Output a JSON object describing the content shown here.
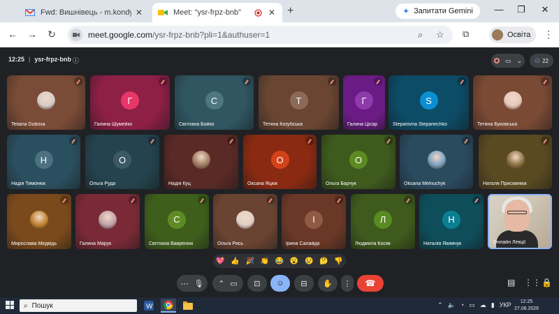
{
  "browser": {
    "tabs": [
      {
        "title": "Fwd: Вишнівець - m.kondyrjeva@",
        "icon": "gmail-icon",
        "active": false
      },
      {
        "title": "Meet: \"ysr-frpz-bnb\"",
        "icon": "meet-icon",
        "active": true
      }
    ],
    "gemini_button": "Запитати Gemini",
    "url_host": "meet.google.com",
    "url_rest": "/ysr-frpz-bnb?pli=1&authuser=1",
    "profile_name": "Освіта"
  },
  "meeting": {
    "time": "12:25",
    "code": "ysr-frpz-bnb",
    "participants_count": "22",
    "tiles": [
      {
        "name": "Tetiana Dubova",
        "letter": "",
        "photo": true,
        "color": "#7a4b36",
        "avcolor": "#d7ccc8"
      },
      {
        "name": "Галина Шумейко",
        "letter": "Г",
        "photo": false,
        "color": "#8e1f45",
        "avcolor": "#e8366a"
      },
      {
        "name": "Світлана Бойко",
        "letter": "С",
        "photo": false,
        "color": "#2f5661",
        "avcolor": "#4f7782"
      },
      {
        "name": "Тетяна Козубська",
        "letter": "Т",
        "photo": false,
        "color": "#6a4632",
        "avcolor": "#8b6a58"
      },
      {
        "name": "Галина Цісар",
        "letter": "Г",
        "photo": false,
        "color": "#6a1b84",
        "avcolor": "#8e3aaa"
      },
      {
        "name": "Stepanivna Stepanechko",
        "letter": "S",
        "photo": false,
        "color": "#0d4c66",
        "avcolor": "#0b8fd3"
      },
      {
        "name": "Тетяна Буковська",
        "letter": "",
        "photo": true,
        "color": "#7a4a35",
        "avcolor": "#e8c8b8"
      },
      {
        "name": "Надія Тимонюк",
        "letter": "Н",
        "photo": false,
        "color": "#2a4f5e",
        "avcolor": "#4d7181"
      },
      {
        "name": "Ольга Руда",
        "letter": "О",
        "photo": false,
        "color": "#24434e",
        "avcolor": "#3b5964"
      },
      {
        "name": "Надія Куц",
        "letter": "",
        "photo": true,
        "color": "#5a2a26",
        "avcolor": "#a07a62"
      },
      {
        "name": "Оксана Яцюк",
        "letter": "О",
        "photo": false,
        "color": "#8a2a12",
        "avcolor": "#d4421a"
      },
      {
        "name": "Ольга Барчук",
        "letter": "О",
        "photo": false,
        "color": "#3e5a1d",
        "avcolor": "#5d8a22"
      },
      {
        "name": "Oksana Melnuchyk",
        "letter": "",
        "photo": true,
        "color": "#2a4a5e",
        "avcolor": "#7aa0c0"
      },
      {
        "name": "Наталя Присяжнюк",
        "letter": "",
        "photo": true,
        "color": "#5a4a22",
        "avcolor": "#8a7040"
      },
      {
        "name": "Мирослава Медвідь",
        "letter": "",
        "photo": true,
        "color": "#7a4a1c",
        "avcolor": "#c08030"
      },
      {
        "name": "Галина Марук",
        "letter": "",
        "photo": true,
        "color": "#7a2a36",
        "avcolor": "#c0a0a8"
      },
      {
        "name": "Світлана Вавренюк",
        "letter": "С",
        "photo": false,
        "color": "#3e5e1c",
        "avcolor": "#5d8c24"
      },
      {
        "name": "Ольга Рись",
        "letter": "",
        "photo": true,
        "color": "#6a4432",
        "avcolor": "#e0d0c8"
      },
      {
        "name": "Ірина Салайда",
        "letter": "І",
        "photo": false,
        "color": "#6a3826",
        "avcolor": "#8e5a44"
      },
      {
        "name": "Людмила Косяк",
        "letter": "Л",
        "photo": false,
        "color": "#3e5a1c",
        "avcolor": "#5a8a22"
      },
      {
        "name": "Наталія Якимчук",
        "letter": "Н",
        "photo": false,
        "color": "#0e4e5a",
        "avcolor": "#0b7f92"
      },
      {
        "name": "Онлайн Лекції",
        "letter": "",
        "photo": true,
        "color": "#cfc6b6",
        "avcolor": "#e5b9a4"
      }
    ],
    "reactions": [
      "💖",
      "👍",
      "🎉",
      "👏",
      "😂",
      "😮",
      "😢",
      "🤔",
      "👎"
    ]
  },
  "taskbar": {
    "search_placeholder": "Пошук",
    "lang": "УКР",
    "time": "12:25",
    "date": "27.08.2026"
  },
  "colors": {
    "meet_bg": "#202124",
    "end_call": "#ea4335",
    "active_control": "#8ab4f8"
  }
}
